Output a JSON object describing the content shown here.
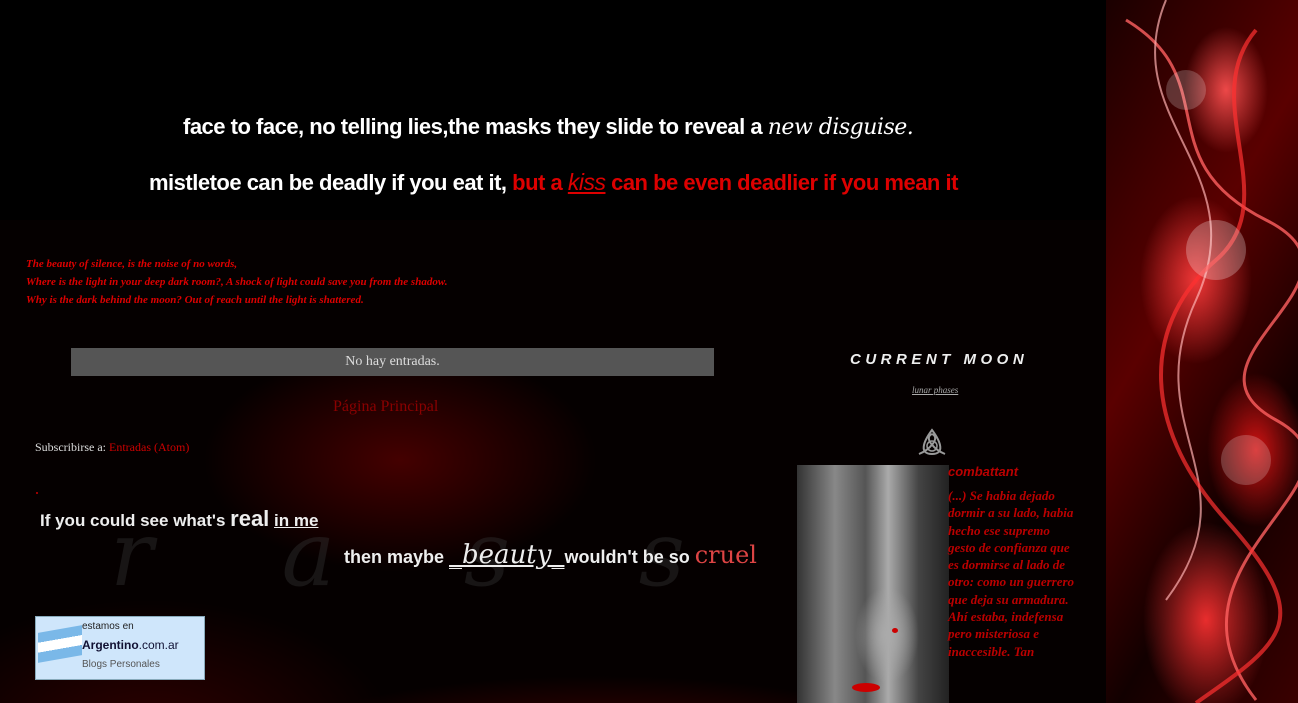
{
  "header": {
    "line1_plain": "face to face, no telling lies,the masks they slide to reveal a ",
    "line1_script": "new disguise.",
    "line2_white": "mistletoe can be deadly if you eat it, ",
    "line2_red_a": "but a ",
    "line2_kiss": "kiss",
    "line2_red_b": " can be even deadlier if you mean it"
  },
  "poem": {
    "lines": [
      "The beauty of silence, is the noise of no words,",
      "Where is the light in your deep dark room?, A shock of light could save you from the shadow.",
      "Why is the dark behind the moon? Out of reach until the light is shattered."
    ]
  },
  "main": {
    "no_posts": "No hay entradas.",
    "home_link": "Página Principal",
    "subscribe_label": "Subscribirse a: ",
    "subscribe_link": "Entradas (Atom)"
  },
  "quote_image": {
    "part1": "If you could see what's ",
    "real": "real",
    "part2": " ",
    "in_me": "in me",
    "part3": "then maybe ",
    "beauty": "_beauty_",
    "part4": "wouldn't be so ",
    "cruel": "cruel"
  },
  "badge": {
    "line1": "estamos en",
    "brand": "Argentino",
    "domain": ".com.ar",
    "line3": "Blogs Personales",
    "flag_icon": "argentina-flag-icon"
  },
  "sidebar": {
    "moon_title": "CURRENT MOON",
    "moon_link": "lunar phases",
    "triquetra_icon": "triquetra-icon",
    "post_title": "combattant",
    "post_text": "(...) Se habia dejado dormir a su lado, habia hecho ese supremo gesto de confianza que es dormirse al lado de otro: como un guerrero que deja su armadura. Ahí estaba, indefensa pero misteriosa e inaccesible. Tan"
  },
  "colors": {
    "accent_red": "#dd0000",
    "background": "#000000"
  }
}
